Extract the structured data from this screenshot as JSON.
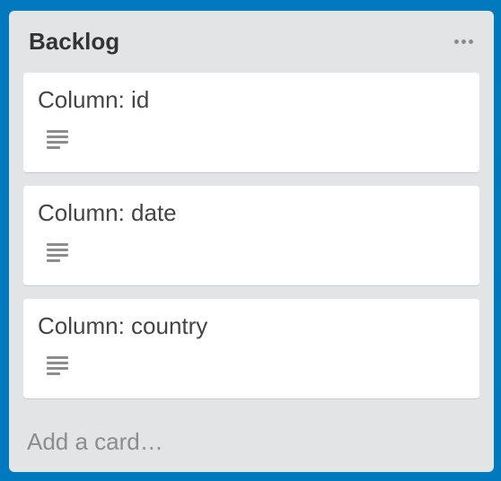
{
  "list": {
    "title": "Backlog",
    "add_card_label": "Add a card…"
  },
  "cards": [
    {
      "title": "Column: id",
      "icon": "description-icon"
    },
    {
      "title": "Column: date",
      "icon": "description-icon"
    },
    {
      "title": "Column: country",
      "icon": "description-icon"
    }
  ],
  "colors": {
    "board_background": "#0079bf",
    "list_background": "#e2e4e6",
    "card_background": "#ffffff"
  }
}
